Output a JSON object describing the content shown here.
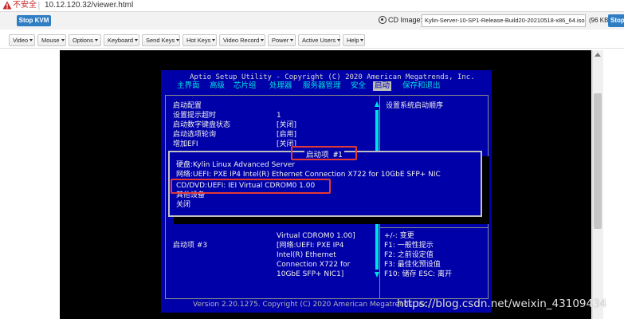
{
  "browser": {
    "insecure_label": "不安全",
    "separator": "|",
    "url": "10.12.120.32/viewer.html"
  },
  "toolbar": {
    "stop_kvm_label": "Stop KVM",
    "cd_image_label": "CD Image:",
    "cd_image_value": "Kylin-Server-10-SP1-Release-Build20-20210518-x86_64.iso",
    "cd_image_size": "(96 KB)",
    "stop_cd_label": "Stop"
  },
  "menus": [
    {
      "label": "Video"
    },
    {
      "label": "Mouse"
    },
    {
      "label": "Options"
    },
    {
      "label": "Keyboard"
    },
    {
      "label": "Send Keys"
    },
    {
      "label": "Hot Keys"
    },
    {
      "label": "Video Record"
    },
    {
      "label": "Power"
    },
    {
      "label": "Active Users"
    },
    {
      "label": "Help"
    }
  ],
  "bios": {
    "title": "Aptio Setup Utility - Copyright (C) 2020 American Megatrends, Inc.",
    "tabs": [
      "主界面",
      "高级",
      "芯片组",
      "处理器",
      "服务器管理",
      "安全",
      "启动",
      "保存和退出"
    ],
    "active_tab": "启动",
    "section_title": "启动配置",
    "settings": [
      {
        "label": "设置提示超时",
        "value": "1"
      },
      {
        "label": "启动数字键盘状态",
        "value": "[关闭]"
      },
      {
        "label": "启动选项轮询",
        "value": "[启用]"
      },
      {
        "label": "增加EFI",
        "value": "[关闭]"
      }
    ],
    "help_text": "设置系统启动顺序",
    "lower_values": [
      "Virtual CDROM0 1.00]",
      "[网络:UEFI: PXE IP4",
      "Intel(R) Ethernet",
      "Connection X722 for",
      "10GbE SFP+ NIC1]"
    ],
    "boot_option_label": "启动项 #3",
    "keys": [
      "+/-: 变更",
      "F1: 一般性提示",
      "F2: 之前设定值",
      "F3: 最佳化预设值",
      "F10: 储存  ESC: 离开"
    ],
    "footer": "Version 2.20.1275. Copyright (C) 2020 American Megatrends, Inc."
  },
  "popup": {
    "title": "启动项 #1",
    "items": [
      "硬盘:Kylin Linux Advanced Server",
      "网络:UEFI: PXE IP4 Intel(R) Ethernet Connection X722 for 10GbE SFP+ NIC",
      "CD/DVD:UEFI: IEI Virtual CDROM0 1.00",
      "其他设备",
      "关闭"
    ]
  },
  "watermark": "https://blog.csdn.net/weixin_43109434",
  "colors": {
    "bios_background": "#0000a8",
    "bios_highlight": "#00e0e0",
    "annotation_red": "#e53935",
    "kvm_button_blue": "#2f7ec4"
  }
}
